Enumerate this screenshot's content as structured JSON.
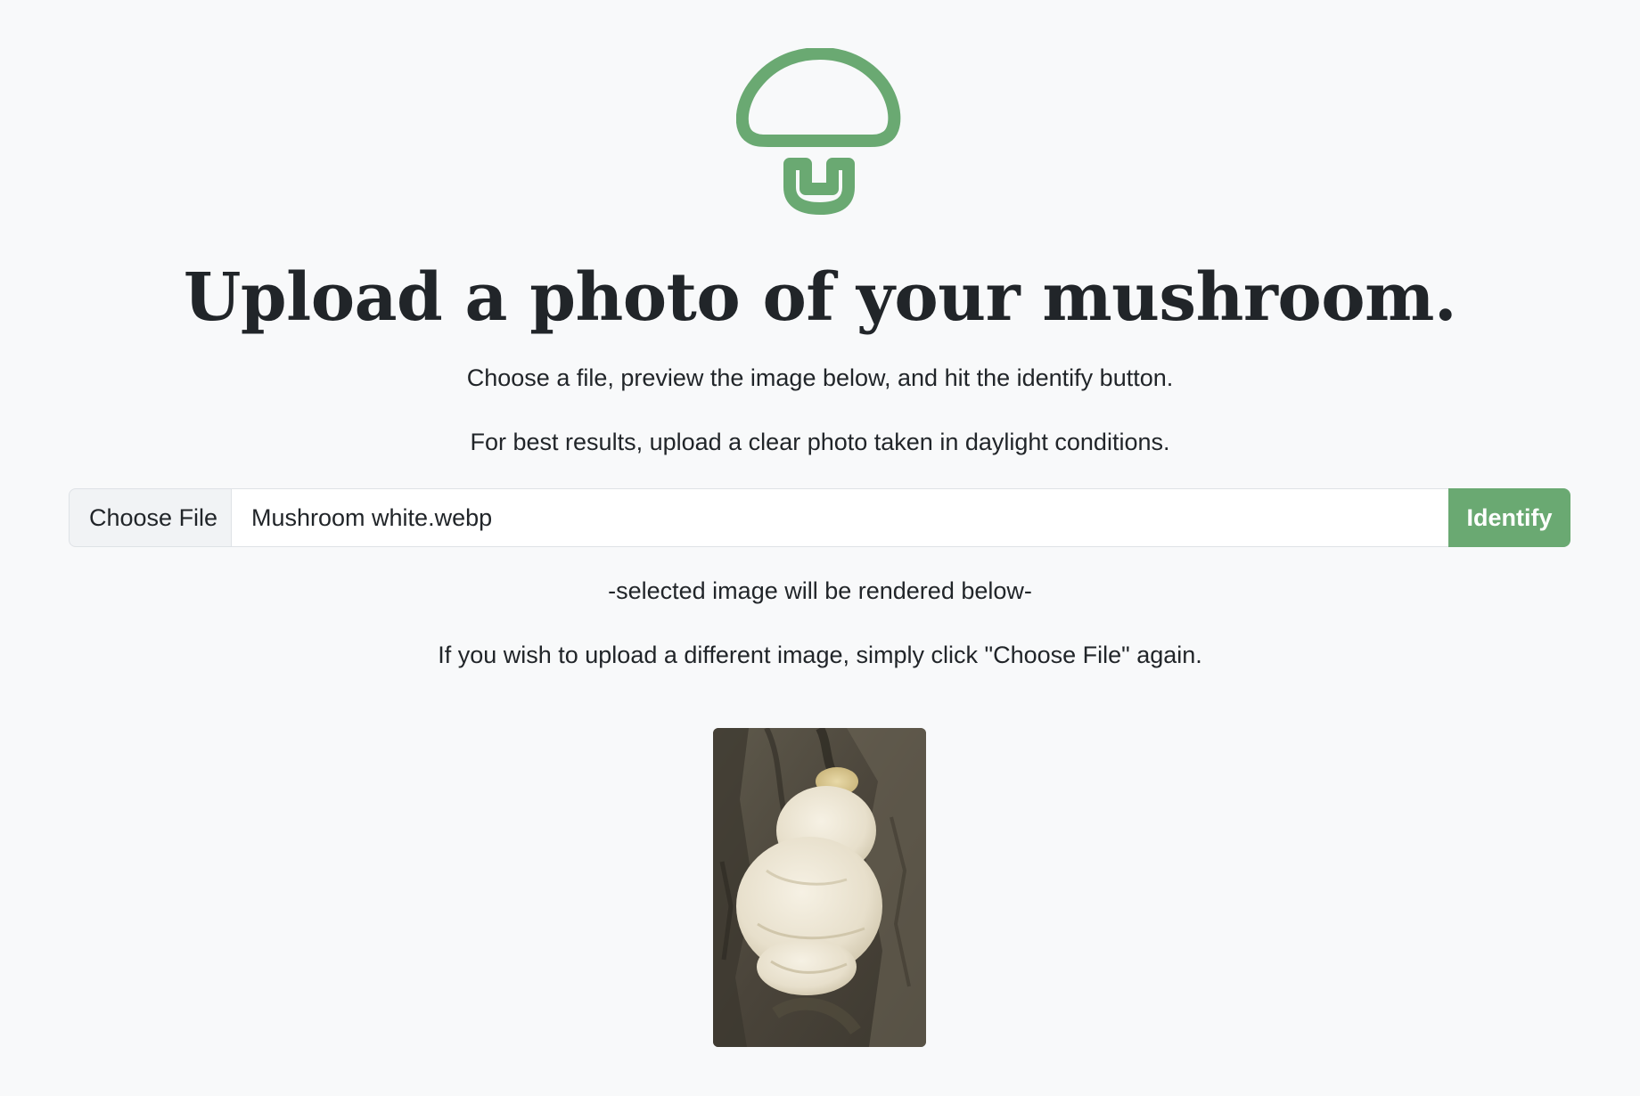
{
  "colors": {
    "brand_green": "#6aa972",
    "background": "#f8f9fa",
    "text": "#212529"
  },
  "logo": {
    "icon": "mushroom-icon"
  },
  "headline": "Upload a photo of your mushroom.",
  "instructions": {
    "line1": "Choose a file, preview the image below, and hit the identify button.",
    "line2": "For best results, upload a clear photo taken in daylight conditions."
  },
  "upload": {
    "choose_label": "Choose File",
    "file_name": "Mushroom white.webp",
    "identify_label": "Identify"
  },
  "notes": {
    "render_hint": "-selected image will be rendered below-",
    "reupload_hint": "If you wish to upload a different image, simply click \"Choose File\" again."
  },
  "preview": {
    "subject": "white shaggy mushroom on tree bark"
  }
}
